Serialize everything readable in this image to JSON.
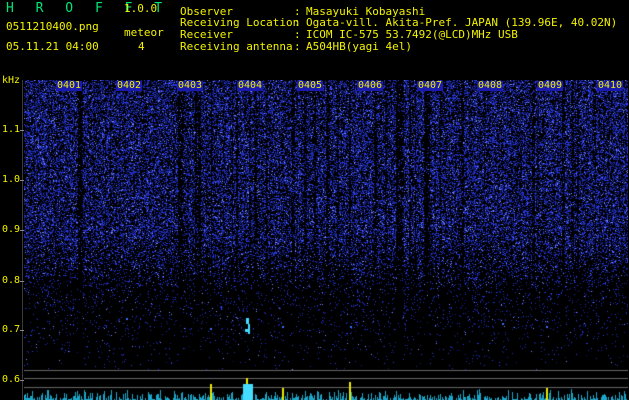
{
  "header": {
    "title": "H R O F F T",
    "version": "1.0.0",
    "filename": "0511210400.png",
    "datetime": "05.11.21 04:00",
    "meteor_label": "meteor",
    "meteor_count": "4"
  },
  "info": [
    {
      "label": "Observer",
      "value": "Masayuki Kobayashi"
    },
    {
      "label": "Receiving Location",
      "value": "Ogata-vill. Akita-Pref. JAPAN (139.96E, 40.02N)"
    },
    {
      "label": "Receiver",
      "value": "ICOM IC-575 53.7492(@LCD)MHz USB"
    },
    {
      "label": "Receiving antenna",
      "value": "A504HB(yagi 4el)"
    }
  ],
  "axis": {
    "unit": "kHz",
    "freq_ticks": [
      "1.1",
      "1.0",
      "0.9",
      "0.8",
      "0.7",
      "0.6"
    ],
    "time_ticks": [
      "0401",
      "0402",
      "0403",
      "0404",
      "0405",
      "0406",
      "0407",
      "0408",
      "0409",
      "0410"
    ]
  },
  "colors": {
    "label_yellow": "#f2f200",
    "label_green": "#00e676",
    "noise_blue": "#2a3cff",
    "echo_cyan": "#44ddff",
    "background": "#000000"
  }
}
